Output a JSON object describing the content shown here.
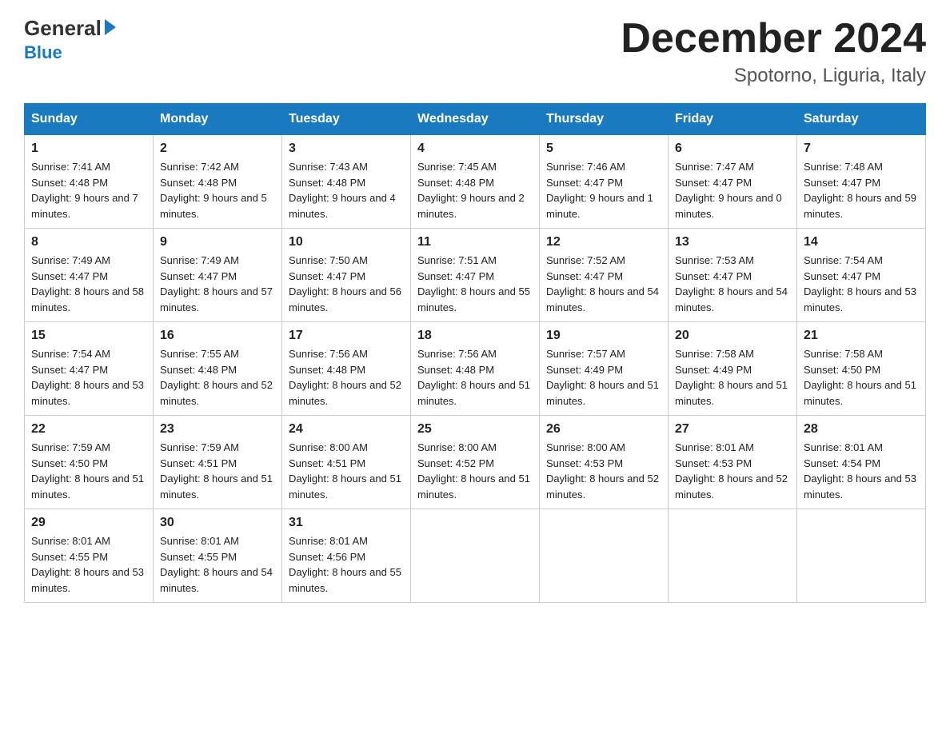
{
  "header": {
    "logo_general": "General",
    "logo_blue": "Blue",
    "title": "December 2024",
    "subtitle": "Spotorno, Liguria, Italy"
  },
  "days_of_week": [
    "Sunday",
    "Monday",
    "Tuesday",
    "Wednesday",
    "Thursday",
    "Friday",
    "Saturday"
  ],
  "weeks": [
    [
      {
        "day": "1",
        "sunrise": "7:41 AM",
        "sunset": "4:48 PM",
        "daylight": "9 hours and 7 minutes."
      },
      {
        "day": "2",
        "sunrise": "7:42 AM",
        "sunset": "4:48 PM",
        "daylight": "9 hours and 5 minutes."
      },
      {
        "day": "3",
        "sunrise": "7:43 AM",
        "sunset": "4:48 PM",
        "daylight": "9 hours and 4 minutes."
      },
      {
        "day": "4",
        "sunrise": "7:45 AM",
        "sunset": "4:48 PM",
        "daylight": "9 hours and 2 minutes."
      },
      {
        "day": "5",
        "sunrise": "7:46 AM",
        "sunset": "4:47 PM",
        "daylight": "9 hours and 1 minute."
      },
      {
        "day": "6",
        "sunrise": "7:47 AM",
        "sunset": "4:47 PM",
        "daylight": "9 hours and 0 minutes."
      },
      {
        "day": "7",
        "sunrise": "7:48 AM",
        "sunset": "4:47 PM",
        "daylight": "8 hours and 59 minutes."
      }
    ],
    [
      {
        "day": "8",
        "sunrise": "7:49 AM",
        "sunset": "4:47 PM",
        "daylight": "8 hours and 58 minutes."
      },
      {
        "day": "9",
        "sunrise": "7:49 AM",
        "sunset": "4:47 PM",
        "daylight": "8 hours and 57 minutes."
      },
      {
        "day": "10",
        "sunrise": "7:50 AM",
        "sunset": "4:47 PM",
        "daylight": "8 hours and 56 minutes."
      },
      {
        "day": "11",
        "sunrise": "7:51 AM",
        "sunset": "4:47 PM",
        "daylight": "8 hours and 55 minutes."
      },
      {
        "day": "12",
        "sunrise": "7:52 AM",
        "sunset": "4:47 PM",
        "daylight": "8 hours and 54 minutes."
      },
      {
        "day": "13",
        "sunrise": "7:53 AM",
        "sunset": "4:47 PM",
        "daylight": "8 hours and 54 minutes."
      },
      {
        "day": "14",
        "sunrise": "7:54 AM",
        "sunset": "4:47 PM",
        "daylight": "8 hours and 53 minutes."
      }
    ],
    [
      {
        "day": "15",
        "sunrise": "7:54 AM",
        "sunset": "4:47 PM",
        "daylight": "8 hours and 53 minutes."
      },
      {
        "day": "16",
        "sunrise": "7:55 AM",
        "sunset": "4:48 PM",
        "daylight": "8 hours and 52 minutes."
      },
      {
        "day": "17",
        "sunrise": "7:56 AM",
        "sunset": "4:48 PM",
        "daylight": "8 hours and 52 minutes."
      },
      {
        "day": "18",
        "sunrise": "7:56 AM",
        "sunset": "4:48 PM",
        "daylight": "8 hours and 51 minutes."
      },
      {
        "day": "19",
        "sunrise": "7:57 AM",
        "sunset": "4:49 PM",
        "daylight": "8 hours and 51 minutes."
      },
      {
        "day": "20",
        "sunrise": "7:58 AM",
        "sunset": "4:49 PM",
        "daylight": "8 hours and 51 minutes."
      },
      {
        "day": "21",
        "sunrise": "7:58 AM",
        "sunset": "4:50 PM",
        "daylight": "8 hours and 51 minutes."
      }
    ],
    [
      {
        "day": "22",
        "sunrise": "7:59 AM",
        "sunset": "4:50 PM",
        "daylight": "8 hours and 51 minutes."
      },
      {
        "day": "23",
        "sunrise": "7:59 AM",
        "sunset": "4:51 PM",
        "daylight": "8 hours and 51 minutes."
      },
      {
        "day": "24",
        "sunrise": "8:00 AM",
        "sunset": "4:51 PM",
        "daylight": "8 hours and 51 minutes."
      },
      {
        "day": "25",
        "sunrise": "8:00 AM",
        "sunset": "4:52 PM",
        "daylight": "8 hours and 51 minutes."
      },
      {
        "day": "26",
        "sunrise": "8:00 AM",
        "sunset": "4:53 PM",
        "daylight": "8 hours and 52 minutes."
      },
      {
        "day": "27",
        "sunrise": "8:01 AM",
        "sunset": "4:53 PM",
        "daylight": "8 hours and 52 minutes."
      },
      {
        "day": "28",
        "sunrise": "8:01 AM",
        "sunset": "4:54 PM",
        "daylight": "8 hours and 53 minutes."
      }
    ],
    [
      {
        "day": "29",
        "sunrise": "8:01 AM",
        "sunset": "4:55 PM",
        "daylight": "8 hours and 53 minutes."
      },
      {
        "day": "30",
        "sunrise": "8:01 AM",
        "sunset": "4:55 PM",
        "daylight": "8 hours and 54 minutes."
      },
      {
        "day": "31",
        "sunrise": "8:01 AM",
        "sunset": "4:56 PM",
        "daylight": "8 hours and 55 minutes."
      },
      null,
      null,
      null,
      null
    ]
  ],
  "labels": {
    "sunrise": "Sunrise:",
    "sunset": "Sunset:",
    "daylight": "Daylight:"
  }
}
